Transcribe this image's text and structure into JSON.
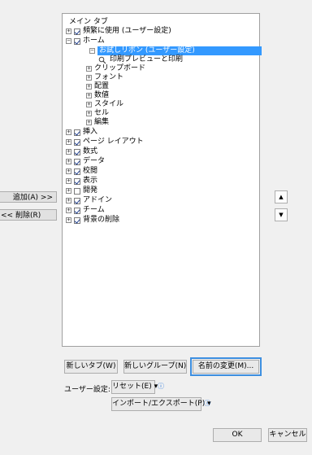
{
  "tree": {
    "header": "メイン タブ",
    "items": [
      {
        "label": "頻繁に使用 (ユーザー設定)",
        "expander": "+",
        "checked": true
      },
      {
        "label": "ホーム",
        "expander": "-",
        "checked": true
      },
      {
        "label": "お試しリボン (ユーザー設定)",
        "expander": "-",
        "selected": true
      },
      {
        "label": "印刷プレビューと印刷"
      },
      {
        "label": "クリップボード",
        "expander": "+"
      },
      {
        "label": "フォント",
        "expander": "+"
      },
      {
        "label": "配置",
        "expander": "+"
      },
      {
        "label": "数値",
        "expander": "+"
      },
      {
        "label": "スタイル",
        "expander": "+"
      },
      {
        "label": "セル",
        "expander": "+"
      },
      {
        "label": "編集",
        "expander": "+"
      },
      {
        "label": "挿入",
        "expander": "+",
        "checked": true
      },
      {
        "label": "ページ レイアウト",
        "expander": "+",
        "checked": true
      },
      {
        "label": "数式",
        "expander": "+",
        "checked": true
      },
      {
        "label": "データ",
        "expander": "+",
        "checked": true
      },
      {
        "label": "校閲",
        "expander": "+",
        "checked": true
      },
      {
        "label": "表示",
        "expander": "+",
        "checked": true
      },
      {
        "label": "開発",
        "expander": "+",
        "checked": false
      },
      {
        "label": "アドイン",
        "expander": "+",
        "checked": true
      },
      {
        "label": "チーム",
        "expander": "+",
        "checked": true
      },
      {
        "label": "背景の削除",
        "expander": "+",
        "checked": true
      }
    ]
  },
  "side": {
    "add": "追加(A) >>",
    "remove": "<< 削除(R)"
  },
  "buttons": {
    "new_tab": "新しいタブ(W)",
    "new_group": "新しいグループ(N)",
    "rename": "名前の変更(M)...",
    "customize_label": "ユーザー設定:",
    "reset": "リセット(E) ▾",
    "import_export": "インポート/エクスポート(P) ▾",
    "ok": "OK",
    "cancel": "キャンセル"
  },
  "colors": {
    "selection": "#3399ff",
    "focus_outline": "#3d8fe0"
  }
}
